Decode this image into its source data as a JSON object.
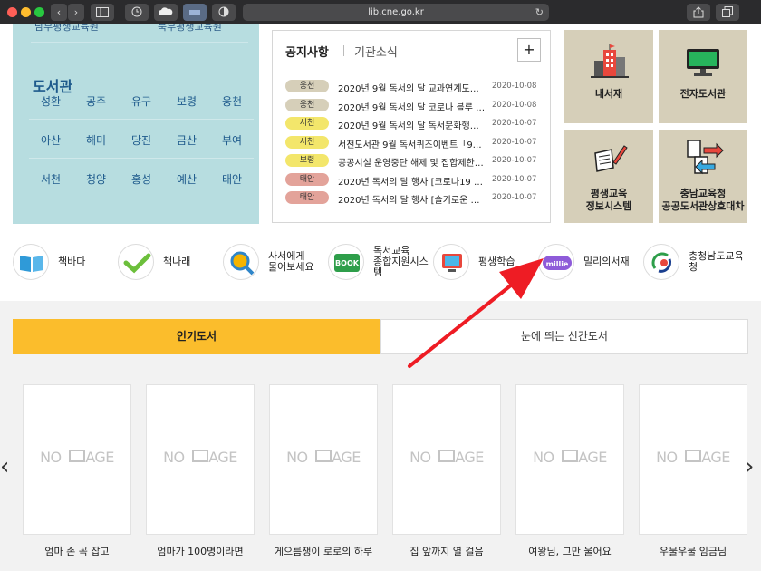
{
  "browser": {
    "url": "lib.cne.go.kr",
    "traffic_lights": [
      "#ff5f57",
      "#febc2e",
      "#28c840"
    ]
  },
  "library_panel": {
    "top_cut_left": "남부평생교육원",
    "top_cut_right": "북부평생교육원",
    "title": "도서관",
    "rows": [
      [
        "성환",
        "공주",
        "유구",
        "보령",
        "웅천"
      ],
      [
        "아산",
        "해미",
        "당진",
        "금산",
        "부여"
      ],
      [
        "서천",
        "청양",
        "홍성",
        "예산",
        "태안"
      ]
    ]
  },
  "notice": {
    "tab_active": "공지사항",
    "tab_inactive": "기관소식",
    "plus": "+",
    "items": [
      {
        "badge": "웅천",
        "badge_color": "#d6cfb9",
        "title": "2020년 9월 독서의 달 교과연계도서 …",
        "date": "2020-10-08"
      },
      {
        "badge": "웅천",
        "badge_color": "#d6cfb9",
        "title": "2020년 9월 독서의 달 코로나 블루 극…",
        "date": "2020-10-08"
      },
      {
        "badge": "서천",
        "badge_color": "#f3e66b",
        "title": "2020년 9월 독서의 달 독서문화행사 …",
        "date": "2020-10-07"
      },
      {
        "badge": "서천",
        "badge_color": "#f3e66b",
        "title": "서천도서관 9월 독서퀴즈이벤트「9…",
        "date": "2020-10-07"
      },
      {
        "badge": "보령",
        "badge_color": "#f3e66b",
        "title": "공공시설 운영중단 해제 및 집합제한…",
        "date": "2020-10-07"
      },
      {
        "badge": "태안",
        "badge_color": "#e3a39a",
        "title": "2020년 독서의 달 행사 [코로나19 O…",
        "date": "2020-10-07"
      },
      {
        "badge": "태안",
        "badge_color": "#e3a39a",
        "title": "2020년 독서의 달 행사 [슬기로운 집…",
        "date": "2020-10-07"
      }
    ]
  },
  "tiles": {
    "my_library": "내서재",
    "ebook_library": "전자도서관",
    "lifelong_line1": "평생교육",
    "lifelong_line2": "정보시스템",
    "interloan_line1": "충남교육청",
    "interloan_line2": "공공도서관상호대차"
  },
  "quick_links": [
    {
      "label": "책바다"
    },
    {
      "label": "책나래"
    },
    {
      "label": "사서에게\n물어보세요"
    },
    {
      "label": "독서교육\n종합지원시스\n템"
    },
    {
      "label": "평생학습"
    },
    {
      "label": "밀리의서재"
    },
    {
      "label": "충청남도교육\n청"
    }
  ],
  "quick_icons": {
    "book_badge": "BOOK",
    "millie_badge": "millie"
  },
  "books": {
    "tab_active": "인기도서",
    "tab_inactive": "눈에 띄는 신간도서",
    "no_image_left": "NO ",
    "no_image_right": "AGE",
    "items": [
      {
        "title": "엄마 손 꼭 잡고"
      },
      {
        "title": "엄마가 100명이라면"
      },
      {
        "title": "게으름쟁이 로로의 하루"
      },
      {
        "title": "집 앞까지 열 걸음"
      },
      {
        "title": "여왕님, 그만 울어요"
      },
      {
        "title": "우물우물 임금님"
      }
    ],
    "prev": "‹",
    "next": "›"
  },
  "colors": {
    "library_bg": "#b7dde0",
    "tile_bg": "#d6cfb9",
    "active_tab": "#fbbd2c",
    "annotation_arrow": "#ee1c24"
  }
}
